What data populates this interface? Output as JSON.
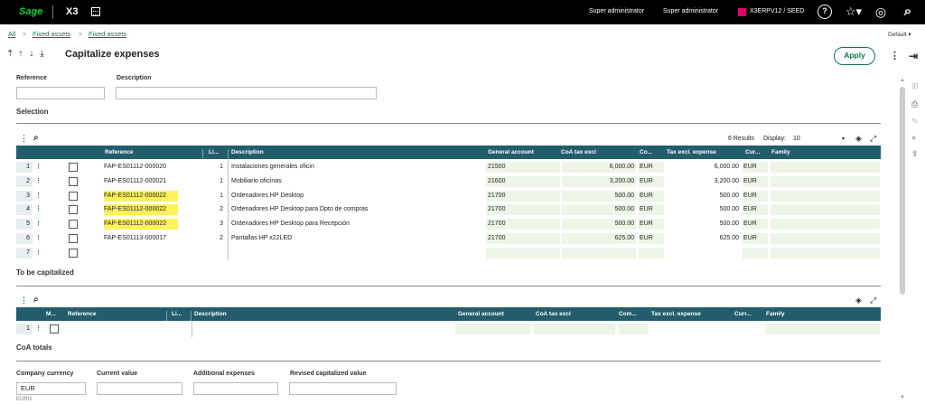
{
  "topbar": {
    "logo": "Sage",
    "product": "X3",
    "user1": "Super administrator",
    "user2": "Super administrator",
    "endpoint": "X3ERPV12 / SEED",
    "help_glyph": "?",
    "star_glyph": "☆▾",
    "compass_glyph": "◎",
    "search_glyph": "⌕",
    "endpoint_color": "#e0006d"
  },
  "breadcrumb": {
    "items": [
      "All",
      "Fixed assets",
      "Fixed assets"
    ],
    "separator": ">"
  },
  "header": {
    "title": "Capitalize expenses",
    "arrows": [
      "⤒",
      "↑",
      "↓",
      "⤓"
    ],
    "apply_label": "Apply",
    "default_label": "Default ▾"
  },
  "filters": {
    "reference_label": "Reference",
    "description_label": "Description",
    "reference_value": "",
    "description_value": ""
  },
  "selection": {
    "title": "Selection",
    "results": "6 Results",
    "display_label": "Display:",
    "display_value": "10",
    "columns": [
      "Reference",
      "Li...",
      "Description",
      "General account",
      "CoA tax excl",
      "Co...",
      "Tax excl. expense",
      "Cur...",
      "Family"
    ],
    "rows": [
      {
        "num": "1",
        "reference": "FAP-ES01112-000020",
        "line": "1",
        "description": "Instalaciones generales oficin",
        "account": "21500",
        "coa_tax": "6,000.00",
        "cur1": "EUR",
        "tax_exp": "6,000.00",
        "cur2": "EUR",
        "family": "",
        "highlight": false
      },
      {
        "num": "2",
        "reference": "FAP-ES01112-000021",
        "line": "1",
        "description": "Mobiliario oficinas",
        "account": "21600",
        "coa_tax": "3,200.00",
        "cur1": "EUR",
        "tax_exp": "3,200.00",
        "cur2": "EUR",
        "family": "",
        "highlight": false
      },
      {
        "num": "3",
        "reference": "FAP-ES01112-000022",
        "line": "1",
        "description": "Ordenadores HP Desktop",
        "account": "21700",
        "coa_tax": "500.00",
        "cur1": "EUR",
        "tax_exp": "500.00",
        "cur2": "EUR",
        "family": "",
        "highlight": true
      },
      {
        "num": "4",
        "reference": "FAP-ES01112-000022",
        "line": "2",
        "description": "Ordenadores HP Desktop para Dpto de compras",
        "account": "21700",
        "coa_tax": "500.00",
        "cur1": "EUR",
        "tax_exp": "500.00",
        "cur2": "EUR",
        "family": "",
        "highlight": true
      },
      {
        "num": "5",
        "reference": "FAP-ES01112-000022",
        "line": "3",
        "description": "Ordenadores HP Desktop para Recepción",
        "account": "21700",
        "coa_tax": "500.00",
        "cur1": "EUR",
        "tax_exp": "500.00",
        "cur2": "EUR",
        "family": "",
        "highlight": true
      },
      {
        "num": "6",
        "reference": "FAP-ES01113-000017",
        "line": "2",
        "description": "Pantallas HP x22LED",
        "account": "21700",
        "coa_tax": "625.00",
        "cur1": "EUR",
        "tax_exp": "625.00",
        "cur2": "EUR",
        "family": "",
        "highlight": false
      },
      {
        "num": "7",
        "reference": "",
        "line": "",
        "description": "",
        "account": "",
        "coa_tax": "",
        "cur1": "",
        "tax_exp": "",
        "cur2": "",
        "family": "",
        "highlight": false
      }
    ]
  },
  "capitalized": {
    "title": "To be capitalized",
    "columns": [
      "M...",
      "Reference",
      "Li...",
      "Description",
      "General account",
      "CoA tax excl",
      "Com...",
      "Tax excl. expense",
      "Curr...",
      "Family"
    ],
    "row_num": "1"
  },
  "totals": {
    "title": "CoA totals",
    "company_currency_label": "Company currency",
    "current_value_label": "Current value",
    "additional_label": "Additional expenses",
    "revised_label": "Revised capitalized value",
    "company_currency_value": "EUR",
    "currency_caption": "EURO"
  },
  "colors": {
    "accent": "#0c7a46",
    "grid_header": "#235d6d",
    "highlight": "#fff25a"
  }
}
